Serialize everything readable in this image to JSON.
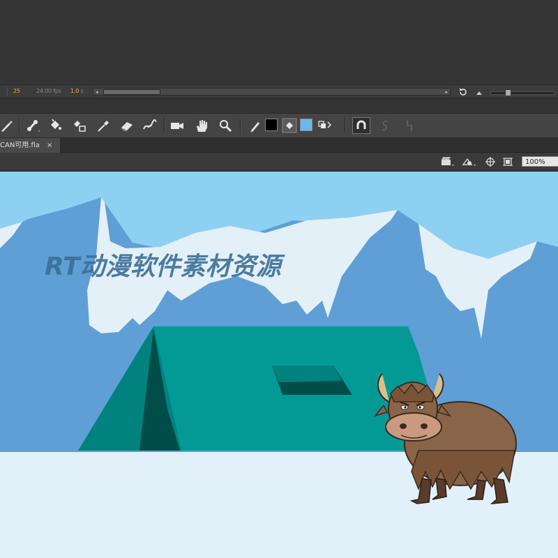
{
  "timeline": {
    "current_frame": "25",
    "frame_rate": "24.00 fps",
    "elapsed_time_value": "1.0",
    "elapsed_time_unit": "s",
    "scroll_left_glyph": "◂",
    "scroll_right_glyph": "▸"
  },
  "toolbar": {
    "tools": [
      "brush-tool",
      "bone-tool",
      "paint-bucket-tool",
      "ink-bottle-tool",
      "eyedropper-tool",
      "eraser-tool",
      "width-tool",
      "camera-tool",
      "hand-tool",
      "zoom-tool",
      "pencil-stroke-color",
      "fill-color"
    ],
    "stroke_color": "#000000",
    "fill_color": "#6ab8f0"
  },
  "document_tab": {
    "filename": "CAN可用.fla",
    "close_glyph": "×"
  },
  "edit_bar": {
    "zoom_value": "100%"
  },
  "stage": {
    "watermark": "RT动漫软件素材资源",
    "colors": {
      "sky": "#8ed0f2",
      "mountain": "#5f9fd6",
      "snow": "#e4f0f8",
      "tent": "#039a96",
      "tent_dark": "#004d4a",
      "ground": "#e2f0fa",
      "yak": "#8a6448"
    }
  }
}
